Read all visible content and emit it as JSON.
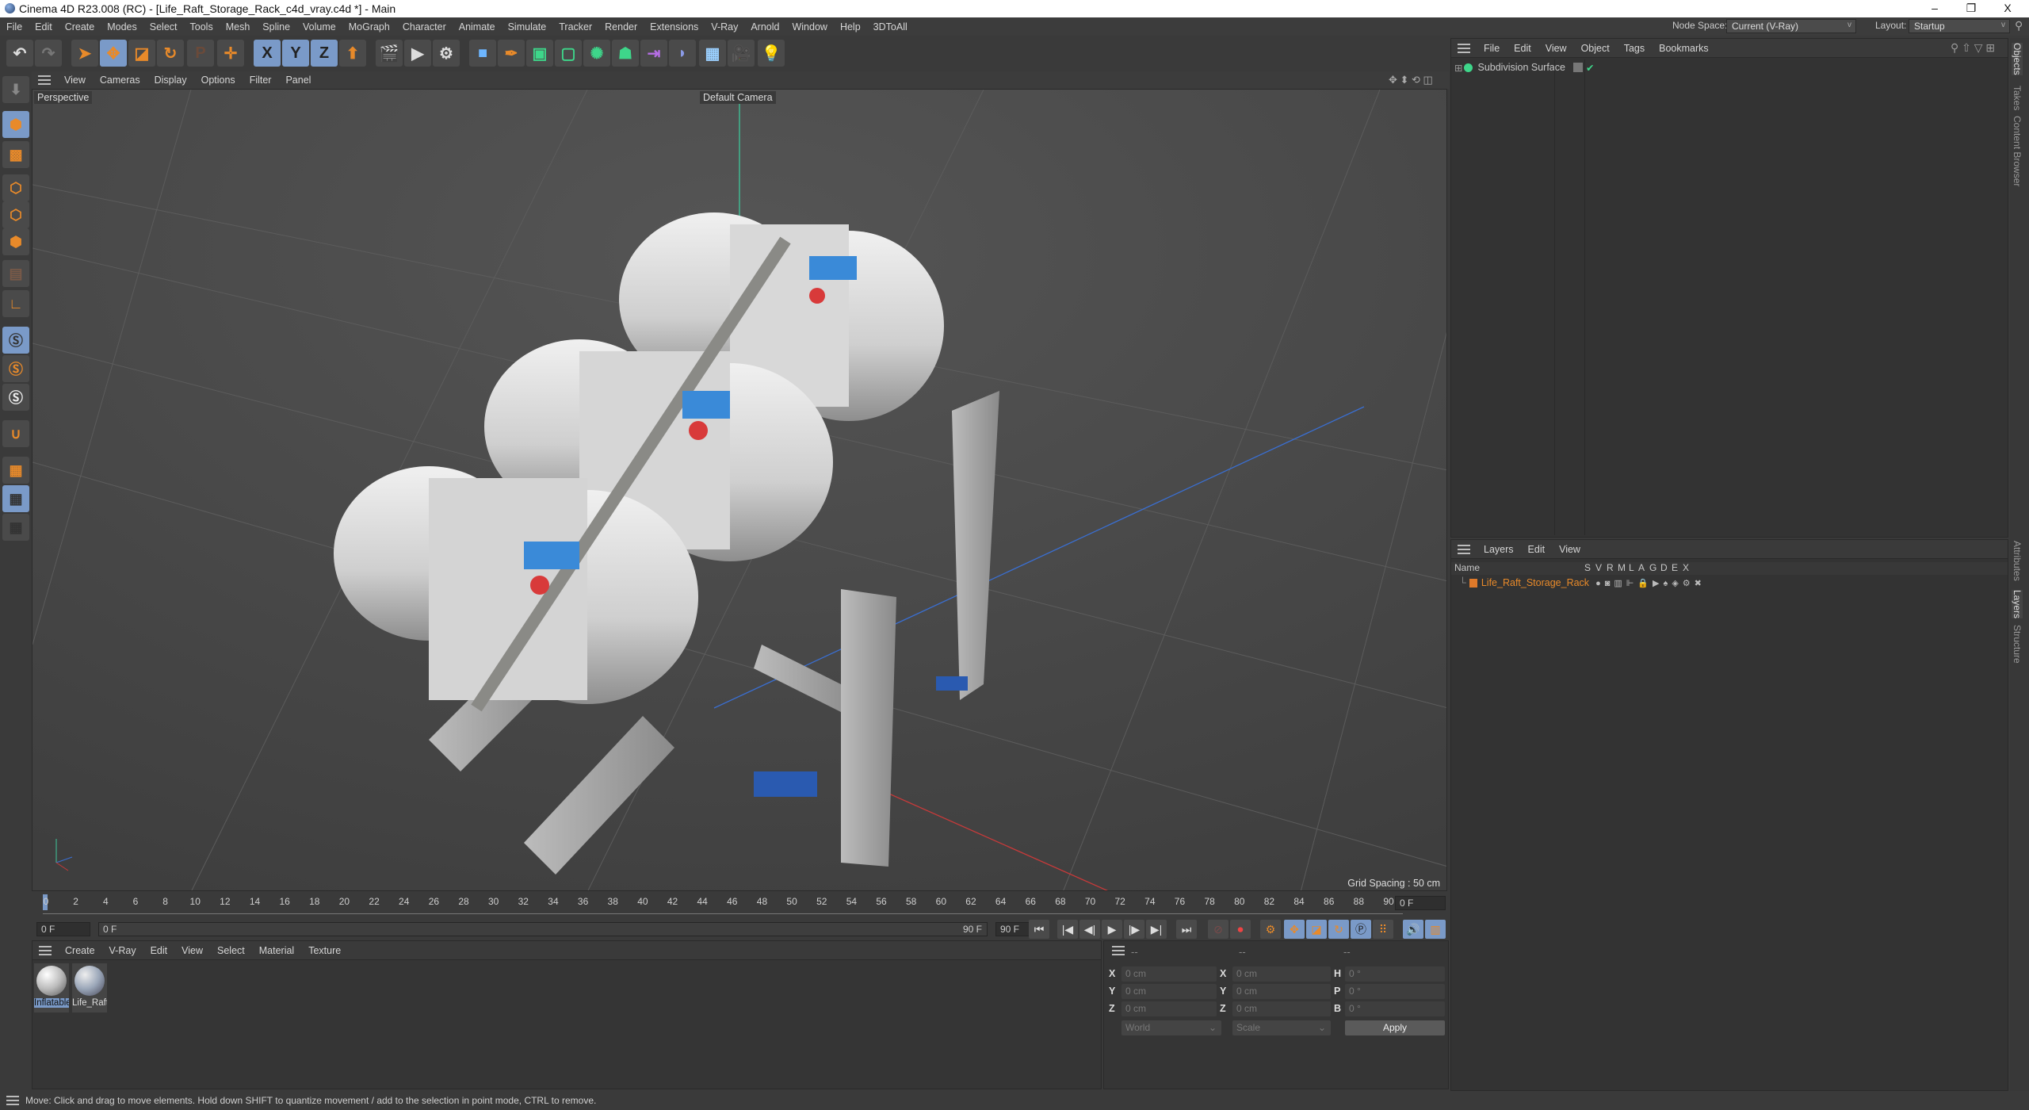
{
  "window": {
    "title": "Cinema 4D R23.008 (RC) - [Life_Raft_Storage_Rack_c4d_vray.c4d *] - Main",
    "controls": [
      "minimize-icon",
      "restore-icon",
      "close-icon"
    ],
    "minimize": "–",
    "restore": "❐",
    "close": "X"
  },
  "menubar": {
    "items": [
      "File",
      "Edit",
      "Create",
      "Modes",
      "Select",
      "Tools",
      "Mesh",
      "Spline",
      "Volume",
      "MoGraph",
      "Character",
      "Animate",
      "Simulate",
      "Tracker",
      "Render",
      "Extensions",
      "V-Ray",
      "Arnold",
      "Window",
      "Help",
      "3DToAll"
    ],
    "node_space_label": "Node Space:",
    "node_space_value": "Current (V-Ray)",
    "layout_label": "Layout:",
    "layout_value": "Startup"
  },
  "toolbar": {
    "undo": "↶",
    "redo": "↷",
    "axis_x": "X",
    "axis_y": "Y",
    "axis_z": "Z"
  },
  "viewport": {
    "menu": [
      "View",
      "Cameras",
      "Display",
      "Options",
      "Filter",
      "Panel"
    ],
    "view_name": "Perspective",
    "camera": "Default Camera",
    "grid_spacing": "Grid Spacing : 50 cm"
  },
  "timeline": {
    "ticks": [
      "0",
      "2",
      "4",
      "6",
      "8",
      "10",
      "12",
      "14",
      "16",
      "18",
      "20",
      "22",
      "24",
      "26",
      "28",
      "30",
      "32",
      "34",
      "36",
      "38",
      "40",
      "42",
      "44",
      "46",
      "48",
      "50",
      "52",
      "54",
      "56",
      "58",
      "60",
      "62",
      "64",
      "66",
      "68",
      "70",
      "72",
      "74",
      "76",
      "78",
      "80",
      "82",
      "84",
      "86",
      "88",
      "90"
    ],
    "current_frame": "0 F",
    "start": "0 F",
    "range_start": "0 F",
    "range_end": "90 F",
    "end": "90 F"
  },
  "materials": {
    "menu": [
      "Create",
      "V-Ray",
      "Edit",
      "View",
      "Select",
      "Material",
      "Texture"
    ],
    "items": [
      {
        "name": "Inflatable",
        "selected": true
      },
      {
        "name": "Life_Raft",
        "selected": false
      }
    ]
  },
  "coordinates": {
    "headers": [
      "--",
      "--",
      "--"
    ],
    "position": [
      {
        "axis": "X",
        "value": "0 cm"
      },
      {
        "axis": "Y",
        "value": "0 cm"
      },
      {
        "axis": "Z",
        "value": "0 cm"
      }
    ],
    "size": [
      {
        "axis": "X",
        "value": "0 cm"
      },
      {
        "axis": "Y",
        "value": "0 cm"
      },
      {
        "axis": "Z",
        "value": "0 cm"
      }
    ],
    "rotation": [
      {
        "axis": "H",
        "value": "0 °"
      },
      {
        "axis": "P",
        "value": "0 °"
      },
      {
        "axis": "B",
        "value": "0 °"
      }
    ],
    "space": "World",
    "mode": "Scale",
    "apply": "Apply"
  },
  "objects": {
    "menu": [
      "File",
      "Edit",
      "View",
      "Object",
      "Tags",
      "Bookmarks"
    ],
    "items": [
      {
        "name": "Subdivision Surface"
      }
    ]
  },
  "layers": {
    "menu": [
      "Layers",
      "Edit",
      "View"
    ],
    "columns": [
      "Name",
      "S",
      "V",
      "R",
      "M",
      "L",
      "A",
      "G",
      "D",
      "E",
      "X"
    ],
    "items": [
      {
        "name": "Life_Raft_Storage_Rack",
        "color": "#e07a2a"
      }
    ]
  },
  "side_tabs": {
    "top": [
      "Objects",
      "Takes",
      "Content Browser"
    ],
    "bottom": [
      "Attributes",
      "Layers",
      "Structure"
    ]
  },
  "status": "Move: Click and drag to move elements. Hold down SHIFT to quantize movement / add to the selection in point mode, CTRL to remove."
}
